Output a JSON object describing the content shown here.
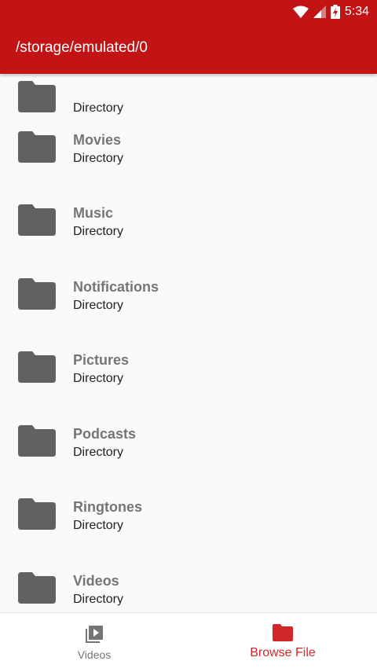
{
  "status": {
    "time": "5:34"
  },
  "appbar": {
    "path": "/storage/emulated/0"
  },
  "items": [
    {
      "name": "",
      "type": "Directory"
    },
    {
      "name": "Movies",
      "type": "Directory"
    },
    {
      "name": "Music",
      "type": "Directory"
    },
    {
      "name": "Notifications",
      "type": "Directory"
    },
    {
      "name": "Pictures",
      "type": "Directory"
    },
    {
      "name": "Podcasts",
      "type": "Directory"
    },
    {
      "name": "Ringtones",
      "type": "Directory"
    },
    {
      "name": "Videos",
      "type": "Directory"
    }
  ],
  "bottom_nav": [
    {
      "label": "Videos",
      "icon": "video-library-icon",
      "active": false
    },
    {
      "label": "Browse File",
      "icon": "folder-icon",
      "active": true
    }
  ],
  "colors": {
    "primary": "#c21414",
    "accent": "#d3262a",
    "folder": "#616161"
  }
}
